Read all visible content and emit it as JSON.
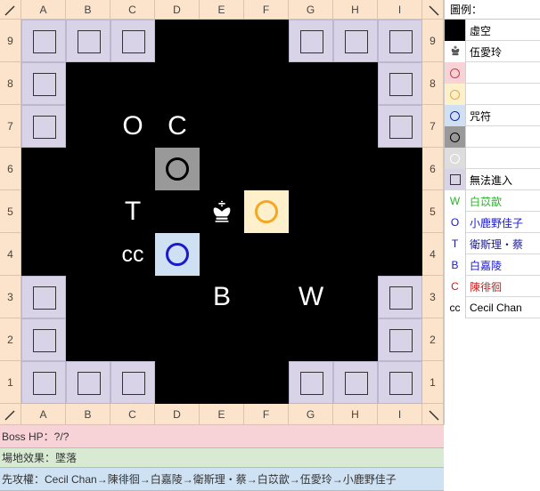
{
  "board": {
    "columns": [
      "A",
      "B",
      "C",
      "D",
      "E",
      "F",
      "G",
      "H",
      "I"
    ],
    "rows": [
      "9",
      "8",
      "7",
      "6",
      "5",
      "4",
      "3",
      "2",
      "1"
    ],
    "blocked_cells": [
      "A9",
      "B9",
      "C9",
      "G9",
      "H9",
      "I9",
      "A8",
      "I8",
      "A7",
      "I7",
      "A3",
      "I3",
      "A2",
      "I2",
      "A1",
      "B1",
      "C1",
      "G1",
      "H1",
      "I1"
    ],
    "markers": [
      {
        "cell": "D6",
        "fill": "#999999",
        "ring": "#000000"
      },
      {
        "cell": "F5",
        "fill": "#fff0cc",
        "ring": "#f5a623"
      },
      {
        "cell": "D4",
        "fill": "#cfe0f3",
        "ring": "#1a1acc"
      }
    ],
    "letters": [
      {
        "cell": "C7",
        "text": "O"
      },
      {
        "cell": "D7",
        "text": "C"
      },
      {
        "cell": "C5",
        "text": "T"
      },
      {
        "cell": "C4",
        "text": "cc"
      },
      {
        "cell": "E3",
        "text": "B"
      },
      {
        "cell": "G3",
        "text": "W"
      }
    ],
    "king_cell": "E5",
    "king_icon": "chess-king-icon"
  },
  "legend": {
    "title": "圖例：",
    "items": [
      {
        "swatch": "black-box",
        "bg": "#000000",
        "label": "虛空",
        "color": "#000000"
      },
      {
        "swatch": "chess-king-icon",
        "bg": "#ffffff",
        "label": "伍愛玲",
        "color": "#000000"
      },
      {
        "swatch": "ring",
        "bg": "#f7d3d8",
        "ring": "#e0303a",
        "label": "",
        "color": "#000000"
      },
      {
        "swatch": "ring",
        "bg": "#fff0cc",
        "ring": "#f5a623",
        "label": "",
        "color": "#000000"
      },
      {
        "swatch": "ring",
        "bg": "#cfe0f3",
        "ring": "#1a1acc",
        "label": "咒符",
        "color": "#000000"
      },
      {
        "swatch": "ring",
        "bg": "#999999",
        "ring": "#000000",
        "label": "",
        "color": "#000000"
      },
      {
        "swatch": "ring",
        "bg": "#dddddd",
        "ring": "#ffffff",
        "label": "",
        "color": "#000000"
      },
      {
        "swatch": "square",
        "bg": "#d9d3e8",
        "label": "無法進入",
        "color": "#000000"
      },
      {
        "swatch": "W",
        "bg": "#ffffff",
        "swatch_color": "#22b822",
        "label": "白苡歆",
        "color": "#22b822"
      },
      {
        "swatch": "O",
        "bg": "#ffffff",
        "swatch_color": "#1a1acc",
        "label": "小鹿野佳子",
        "color": "#1a1acc"
      },
      {
        "swatch": "T",
        "bg": "#ffffff",
        "swatch_color": "#1a1a8c",
        "label": "衛斯理・蔡",
        "color": "#1a1a8c"
      },
      {
        "swatch": "B",
        "bg": "#ffffff",
        "swatch_color": "#1a1acc",
        "label": "白嘉陵",
        "color": "#1a1acc"
      },
      {
        "swatch": "C",
        "bg": "#ffffff",
        "swatch_color": "#cc2020",
        "label": "陳徘徊",
        "color": "#cc2020"
      },
      {
        "swatch": "cc",
        "bg": "#ffffff",
        "swatch_color": "#000000",
        "label": "Cecil Chan",
        "color": "#000000"
      }
    ]
  },
  "status": {
    "boss_hp": "Boss HP：?/?",
    "field_effect": "場地效果：墜落",
    "turn_order": "先攻權：Cecil Chan→陳徘徊→白嘉陵→衛斯理・蔡→白苡歆→伍愛玲→小鹿野佳子"
  },
  "colors": {
    "header_bg": "#fbe3cc",
    "blocked_bg": "#d9d3e8",
    "boss_bar": "#f7d3d8",
    "field_bar": "#d9ead3",
    "turn_bar": "#cfe2f3"
  }
}
